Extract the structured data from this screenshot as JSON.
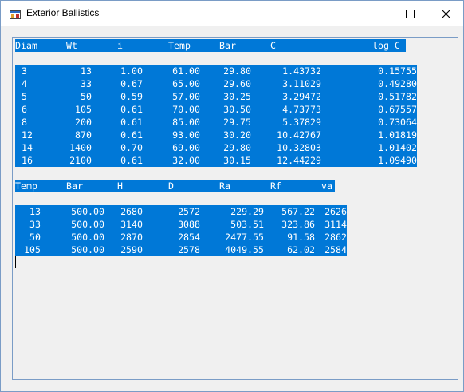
{
  "window": {
    "title": "Exterior Ballistics"
  },
  "table1": {
    "headers": [
      "Diam",
      "Wt",
      "i",
      "Temp",
      "Bar",
      "C",
      "log C"
    ],
    "rows": [
      [
        "3",
        "13",
        "1.00",
        "61.00",
        "29.80",
        "1.43732",
        "0.15755"
      ],
      [
        "4",
        "33",
        "0.67",
        "65.00",
        "29.60",
        "3.11029",
        "0.49280"
      ],
      [
        "5",
        "50",
        "0.59",
        "57.00",
        "30.25",
        "3.29472",
        "0.51782"
      ],
      [
        "6",
        "105",
        "0.61",
        "70.00",
        "30.50",
        "4.73773",
        "0.67557"
      ],
      [
        "8",
        "200",
        "0.61",
        "85.00",
        "29.75",
        "5.37829",
        "0.73064"
      ],
      [
        "12",
        "870",
        "0.61",
        "93.00",
        "30.20",
        "10.42767",
        "1.01819"
      ],
      [
        "14",
        "1400",
        "0.70",
        "69.00",
        "29.80",
        "10.32803",
        "1.01402"
      ],
      [
        "16",
        "2100",
        "0.61",
        "32.00",
        "30.15",
        "12.44229",
        "1.09490"
      ]
    ]
  },
  "table2": {
    "headers": [
      "Temp",
      "Bar",
      "H",
      "D",
      "Ra",
      "Rf",
      "va"
    ],
    "rows": [
      [
        "13",
        "500.00",
        "2680",
        "2572",
        "229.29",
        "567.22",
        "2626"
      ],
      [
        "33",
        "500.00",
        "3140",
        "3088",
        "503.51",
        "323.86",
        "3114"
      ],
      [
        "50",
        "500.00",
        "2870",
        "2854",
        "2477.55",
        "91.58",
        "2862"
      ],
      [
        "105",
        "500.00",
        "2590",
        "2578",
        "4049.55",
        "62.02",
        "2584"
      ]
    ]
  }
}
